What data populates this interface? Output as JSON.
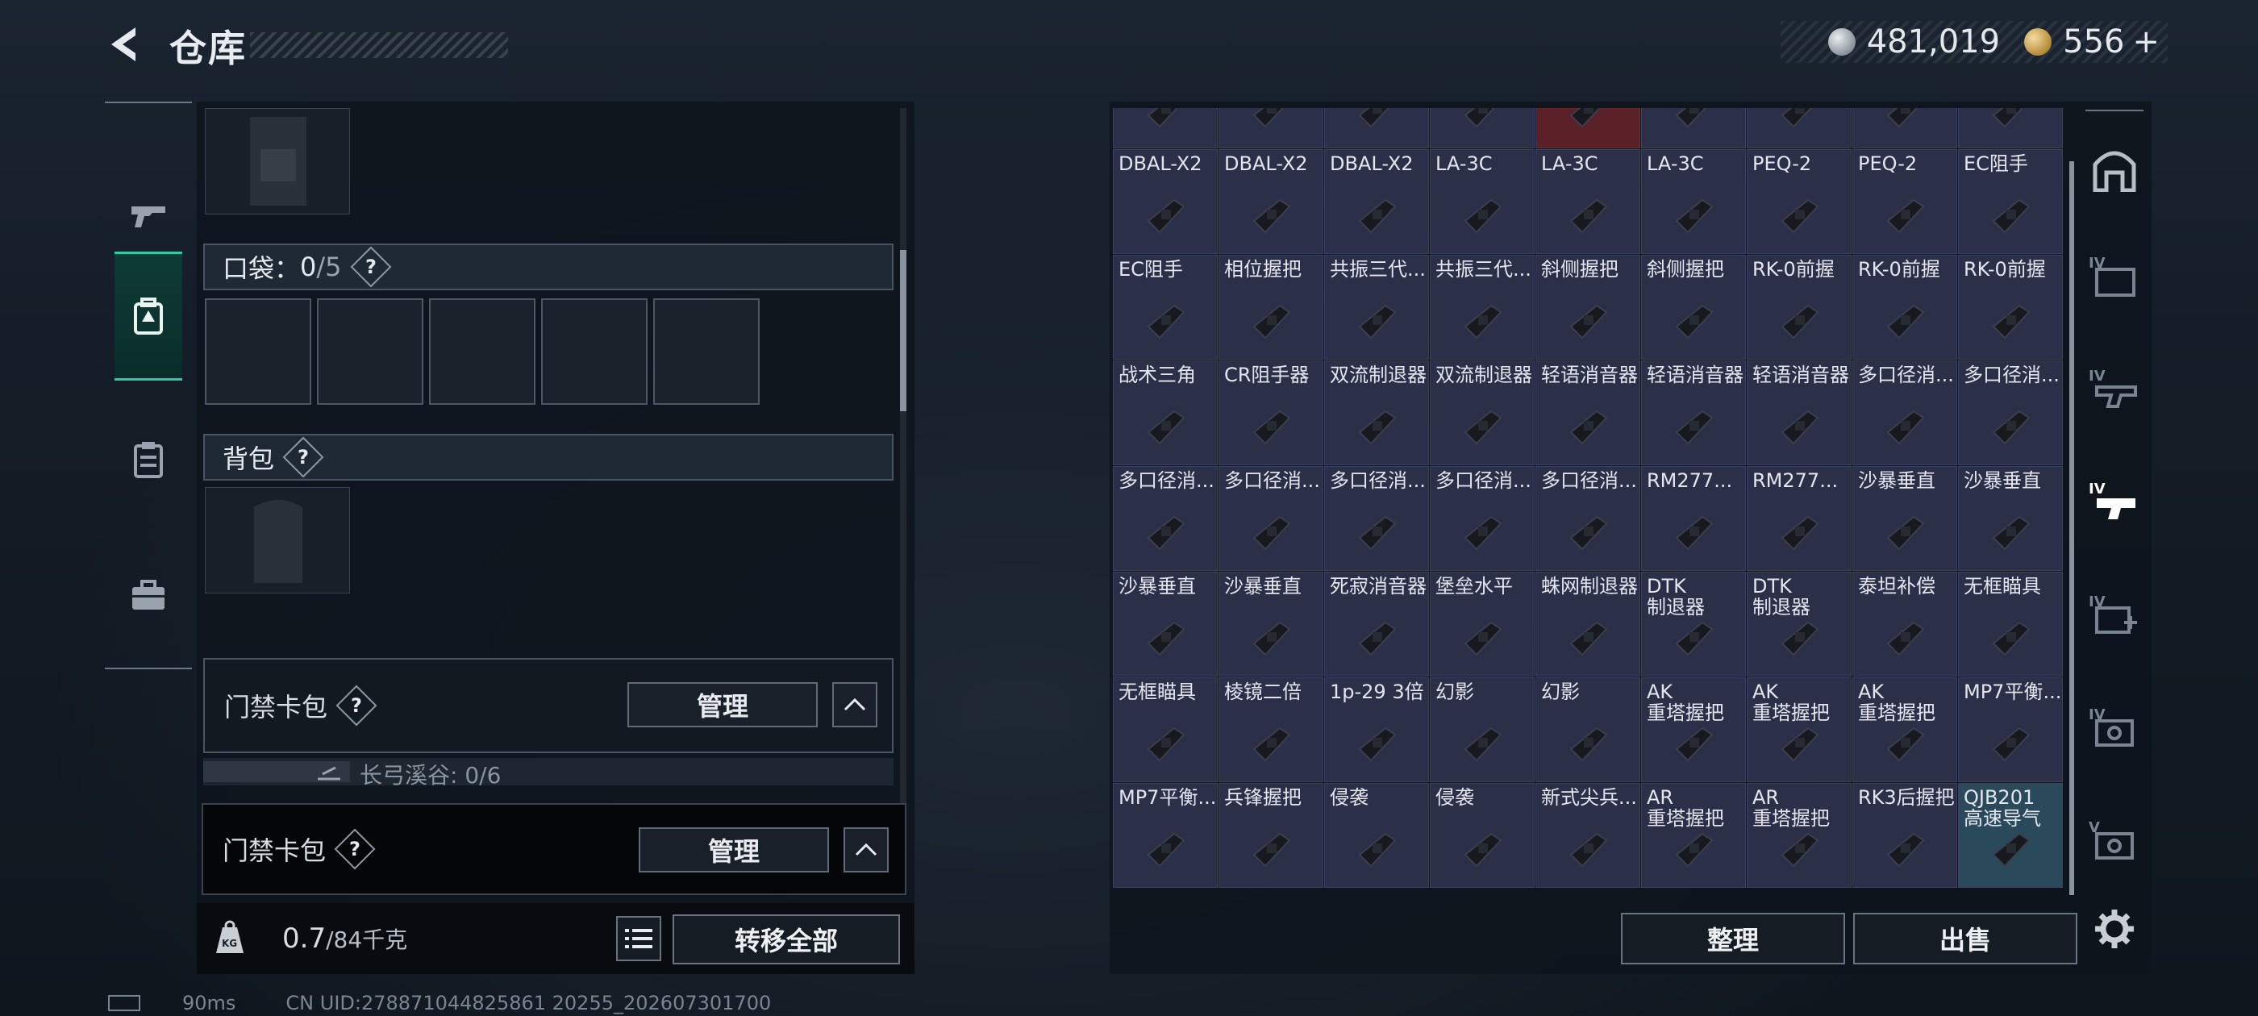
{
  "header": {
    "title": "仓库",
    "currency_silver": "481,019",
    "currency_gold": "556",
    "plus": "+"
  },
  "left_nav": [
    "gun-icon",
    "backpack-icon",
    "clipboard-icon",
    "toolbox-icon"
  ],
  "pockets": {
    "label": "口袋：",
    "count": "0",
    "capacity": "/5"
  },
  "backpack": {
    "label": "背包"
  },
  "card_pack_1": {
    "label": "门禁卡包",
    "manage": "管理"
  },
  "key_sub": {
    "label": "长弓溪谷: 0/6"
  },
  "card_pack_2": {
    "label": "门禁卡包",
    "manage": "管理"
  },
  "weight": {
    "value": "0.7",
    "capacity": "/84千克",
    "unit_badge": "KG"
  },
  "transfer_all": "转移全部",
  "sort_button": "整理",
  "sell_button": "出售",
  "status": {
    "ping": "90ms",
    "uid": "CN UID:278871044825861 20255_202607301700"
  },
  "question": "?",
  "grid": {
    "rows": [
      [
        "",
        "",
        "",
        "",
        "",
        "",
        "",
        "",
        ""
      ],
      [
        "DBAL-X2",
        "DBAL-X2",
        "DBAL-X2",
        "LA-3C",
        "LA-3C",
        "LA-3C",
        "PEQ-2",
        "PEQ-2",
        "EC阻手"
      ],
      [
        "EC阻手",
        "相位握把",
        "共振三代...",
        "共振三代...",
        "斜侧握把",
        "斜侧握把",
        "RK-0前握",
        "RK-0前握",
        "RK-0前握"
      ],
      [
        "战术三角",
        "CR阻手器",
        "双流制退器",
        "双流制退器",
        "轻语消音器",
        "轻语消音器",
        "轻语消音器",
        "多口径消...",
        "多口径消..."
      ],
      [
        "多口径消...",
        "多口径消...",
        "多口径消...",
        "多口径消...",
        "多口径消...",
        "RM277...",
        "RM277...",
        "沙暴垂直",
        "沙暴垂直"
      ],
      [
        "沙暴垂直",
        "沙暴垂直",
        "死寂消音器",
        "堡垒水平",
        "蛛网制退器",
        "DTK\n制退器",
        "DTK\n制退器",
        "泰坦补偿",
        "无框瞄具"
      ],
      [
        "无框瞄具",
        "棱镜二倍",
        "1p-29 3倍",
        "幻影",
        "幻影",
        "AK\n重塔握把",
        "AK\n重塔握把",
        "AK\n重塔握把",
        "MP7平衡..."
      ],
      [
        "MP7平衡...",
        "兵锋握把",
        "侵袭",
        "侵袭",
        "新式尖兵...",
        "AR\n重塔握把",
        "AR\n重塔握把",
        "RK3后握把",
        "QJB201\n高速导气"
      ]
    ]
  }
}
